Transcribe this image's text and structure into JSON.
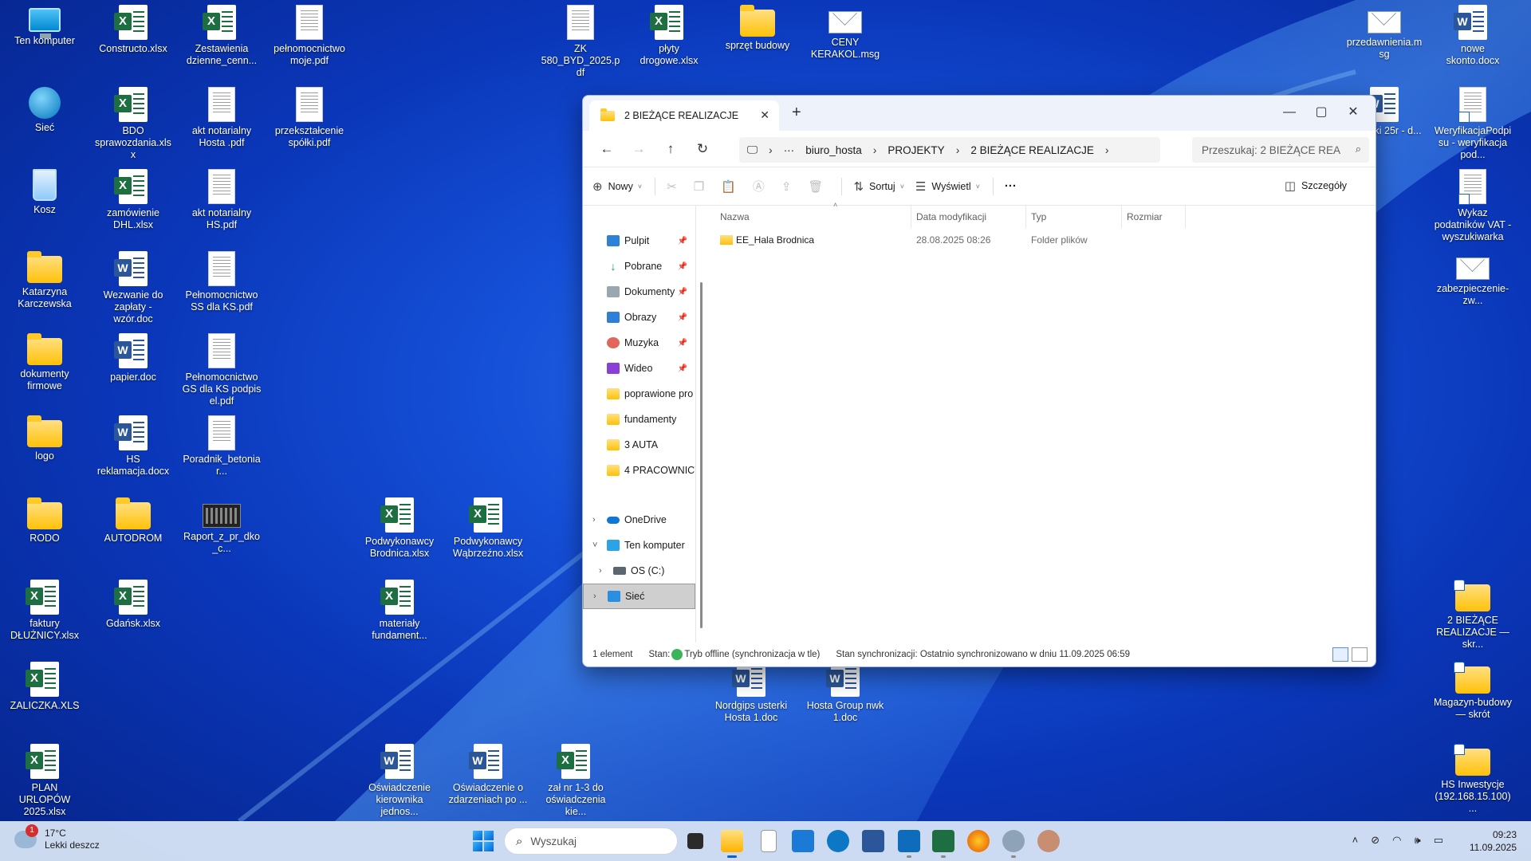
{
  "desktop": {
    "icons": [
      {
        "label": "Ten komputer",
        "icon": "pc-icon"
      },
      {
        "label": "Constructo.xlsx",
        "icon": "excel-icon"
      },
      {
        "label": "Zestawienia dzienne_cenn...",
        "icon": "excel-icon"
      },
      {
        "label": "pełnomocnictwo moje.pdf",
        "icon": "pdf-icon"
      },
      {
        "label": "ZK 580_BYD_2025.pdf",
        "icon": "pdf-icon"
      },
      {
        "label": "płyty drogowe.xlsx",
        "icon": "excel-icon"
      },
      {
        "label": "sprzęt budowy",
        "icon": "folder-icon"
      },
      {
        "label": "CENY KERAKOL.msg",
        "icon": "mail-icon"
      },
      {
        "label": "przedawnienia.msg",
        "icon": "mail-icon"
      },
      {
        "label": "nowe skonto.docx",
        "icon": "word-icon"
      },
      {
        "label": "Sieć",
        "icon": "network-icon"
      },
      {
        "label": "BDO sprawozdania.xlsx",
        "icon": "excel-icon"
      },
      {
        "label": "akt notarialny Hosta .pdf",
        "icon": "pdf-icon"
      },
      {
        "label": "przekształcenie spółki.pdf",
        "icon": "pdf-icon"
      },
      {
        "label": "achunki 25r - d...",
        "icon": "word-icon"
      },
      {
        "label": "WeryfikacjaPodpisu - weryfikacja pod...",
        "icon": "shortcut-icon"
      },
      {
        "label": "Kosz",
        "icon": "recycle-bin-icon"
      },
      {
        "label": "zamówienie DHL.xlsx",
        "icon": "excel-icon"
      },
      {
        "label": "akt notarialny HS.pdf",
        "icon": "pdf-icon"
      },
      {
        "label": "Wykaz podatników VAT - wyszukiwarka",
        "icon": "shortcut-icon"
      },
      {
        "label": "Katarzyna Karczewska",
        "icon": "folder-icon"
      },
      {
        "label": "Wezwanie do zapłaty - wzór.doc",
        "icon": "word-icon"
      },
      {
        "label": "Pełnomocnictwo SS dla KS.pdf",
        "icon": "pdf-icon"
      },
      {
        "label": "zabezpieczenie-zw...",
        "icon": "mail-icon"
      },
      {
        "label": "dokumenty firmowe",
        "icon": "folder-icon"
      },
      {
        "label": "papier.doc",
        "icon": "word-icon"
      },
      {
        "label": "Pełnomocnictwo GS dla KS podpis el.pdf",
        "icon": "pdf-icon"
      },
      {
        "label": "logo",
        "icon": "folder-icon"
      },
      {
        "label": "HS reklamacja.docx",
        "icon": "word-icon"
      },
      {
        "label": "Poradnik_betoniar...",
        "icon": "pdf-icon"
      },
      {
        "label": "RODO",
        "icon": "folder-icon"
      },
      {
        "label": "AUTODROM",
        "icon": "folder-icon"
      },
      {
        "label": "Raport_z_pr_dko_c...",
        "icon": "image-icon"
      },
      {
        "label": "Podwykonawcy Brodnica.xlsx",
        "icon": "excel-icon"
      },
      {
        "label": "Podwykonawcy Wąbrzeźno.xlsx",
        "icon": "excel-icon"
      },
      {
        "label": "faktury DŁUŻNICY.xlsx",
        "icon": "excel-icon"
      },
      {
        "label": "Gdańsk.xlsx",
        "icon": "excel-icon"
      },
      {
        "label": "materiały fundament...",
        "icon": "excel-icon"
      },
      {
        "label": "2 BIEŻĄCE REALIZACJE — skr...",
        "icon": "folder-shortcut-icon"
      },
      {
        "label": "ZALICZKA.XLS",
        "icon": "excel-icon"
      },
      {
        "label": "Nordgips usterki Hosta 1.doc",
        "icon": "word-icon"
      },
      {
        "label": "Hosta Group nwk 1.doc",
        "icon": "word-icon"
      },
      {
        "label": "Magazyn-budowy — skrót",
        "icon": "folder-shortcut-icon"
      },
      {
        "label": "PLAN URLOPÓW 2025.xlsx",
        "icon": "excel-icon"
      },
      {
        "label": "Oświadczenie kierownika jednos...",
        "icon": "word-icon"
      },
      {
        "label": "Oświadczenie o zdarzeniach po ...",
        "icon": "word-icon"
      },
      {
        "label": "zał nr 1-3 do oświadczenia kie...",
        "icon": "excel-icon"
      },
      {
        "label": "HS Inwestycje (192.168.15.100) ...",
        "icon": "folder-shortcut-icon"
      }
    ]
  },
  "explorer": {
    "tab_title": "2 BIEŻĄCE REALIZACJE",
    "tab_close": "✕",
    "new_tab": "+",
    "window_controls": {
      "minimize": "—",
      "maximize": "▢",
      "close": "✕"
    },
    "breadcrumb": {
      "more": "···",
      "items": [
        "biuro_hosta",
        "PROJEKTY",
        "2 BIEŻĄCE REALIZACJE"
      ]
    },
    "search_placeholder": "Przeszukaj: 2 BIEŻĄCE REA",
    "commands": {
      "new": "Nowy",
      "sort": "Sortuj",
      "view": "Wyświetl",
      "more": "···",
      "details": "Szczegóły"
    },
    "nav_pinned": [
      {
        "label": "Pulpit",
        "icon": "desktop-icon"
      },
      {
        "label": "Pobrane",
        "icon": "download-icon"
      },
      {
        "label": "Dokumenty",
        "icon": "documents-icon"
      },
      {
        "label": "Obrazy",
        "icon": "pictures-icon"
      },
      {
        "label": "Muzyka",
        "icon": "music-icon"
      },
      {
        "label": "Wideo",
        "icon": "video-icon"
      }
    ],
    "nav_folders": [
      "poprawione pro",
      "fundamenty",
      "3 AUTA",
      "4 PRACOWNICY"
    ],
    "nav_tree": {
      "onedrive": "OneDrive",
      "this_pc": "Ten komputer",
      "drive": "OS (C:)",
      "network": "Sieć"
    },
    "columns": [
      "Nazwa",
      "Data modyfikacji",
      "Typ",
      "Rozmiar"
    ],
    "rows": [
      {
        "name": "EE_Hala Brodnica",
        "modified": "28.08.2025 08:26",
        "type": "Folder plików",
        "size": ""
      }
    ],
    "status": {
      "count": "1 element",
      "state_label": "Stan:",
      "state_value": "Tryb offline (synchronizacja w tle)",
      "sync": "Stan synchronizacji:  Ostatnio synchronizowano w dniu 11.09.2025 06:59"
    }
  },
  "taskbar": {
    "weather_temp": "17°C",
    "weather_desc": "Lekki deszcz",
    "weather_badge": "1",
    "search_label": "Wyszukaj",
    "clock_time": "09:23",
    "clock_date": "11.09.2025"
  },
  "colors": {
    "accent": "#0a5fd6",
    "excel": "#1d6f42",
    "word": "#2b579a",
    "folder": "#ffc107"
  }
}
